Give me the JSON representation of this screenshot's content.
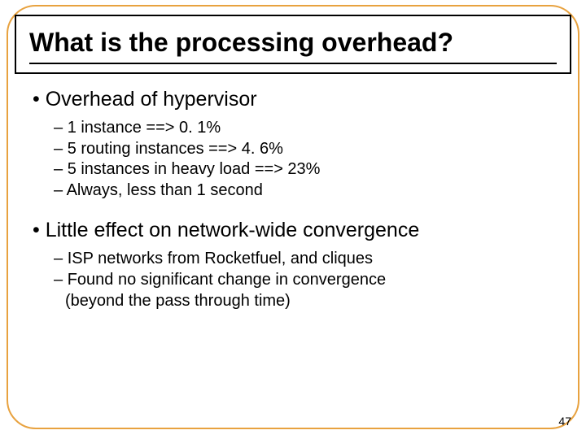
{
  "title": "What is the processing overhead?",
  "bullets": {
    "b1": {
      "label": "Overhead of hypervisor",
      "subs": {
        "s1": "1 instance ==> 0. 1%",
        "s2": "5 routing instances ==> 4. 6%",
        "s3": "5 instances in heavy load ==> 23%",
        "s4": "Always, less than 1 second"
      }
    },
    "b2": {
      "label": "Little effect on network-wide convergence",
      "subs": {
        "s1": "ISP networks from Rocketfuel, and cliques",
        "s2": "Found no significant change in convergence",
        "s2b": "(beyond the pass through time)"
      }
    }
  },
  "slide_number": "47"
}
